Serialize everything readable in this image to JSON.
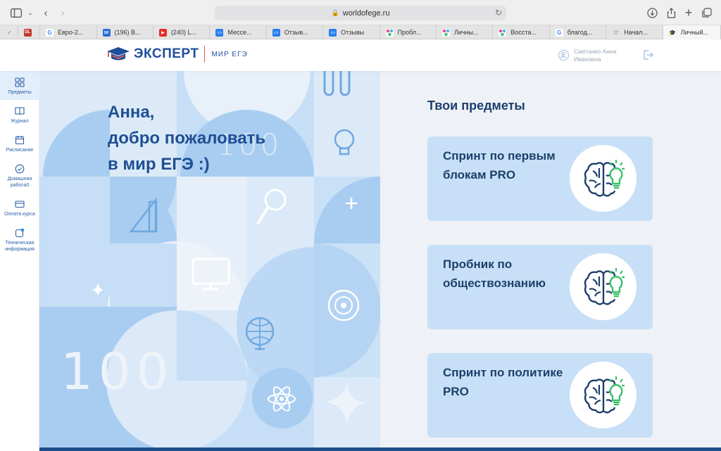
{
  "browser": {
    "url": "worldofege.ru",
    "tabs": [
      {
        "label": "",
        "icon": "check-icon"
      },
      {
        "label": "",
        "icon": "dl-icon"
      },
      {
        "label": "Евро-2...",
        "icon": "google-icon"
      },
      {
        "label": "(196) В...",
        "icon": "mail-icon"
      },
      {
        "label": "(240) L...",
        "icon": "youtube-icon"
      },
      {
        "label": "Мессе...",
        "icon": "chat-icon"
      },
      {
        "label": "Отзыв...",
        "icon": "chat-icon"
      },
      {
        "label": "Отзывы",
        "icon": "chat-icon"
      },
      {
        "label": "Пробл...",
        "icon": "dots-icon"
      },
      {
        "label": "Личны...",
        "icon": "dots-icon"
      },
      {
        "label": "Восста...",
        "icon": "dots-icon"
      },
      {
        "label": "благод...",
        "icon": "google-icon"
      },
      {
        "label": "Начал...",
        "icon": "star-icon"
      },
      {
        "label": "Личный...",
        "icon": "cap-icon"
      }
    ]
  },
  "header": {
    "logo_text": "ЭКСПЕРТ",
    "logo_sub": "МИР ЕГЭ",
    "user_name": "Сметанко Анна Ивановна"
  },
  "nav": [
    {
      "label": "Предметы",
      "icon": "grid-icon"
    },
    {
      "label": "Журнал",
      "icon": "book-icon"
    },
    {
      "label": "Расписание",
      "icon": "calendar-icon"
    },
    {
      "label": "Домашняя работа0",
      "icon": "check-circle-icon"
    },
    {
      "label": "Оплата курса",
      "icon": "card-icon"
    },
    {
      "label": "Техническая информация",
      "icon": "info-icon"
    }
  ],
  "hero": {
    "line1": "Анна,",
    "line2": "добро пожаловать",
    "line3": "в мир ЕГЭ :)",
    "deco_100": "100"
  },
  "subjects": {
    "title": "Твои предметы",
    "cards": [
      {
        "title": "Спринт по первым блокам PRO"
      },
      {
        "title": "Пробник по обществознанию"
      },
      {
        "title": "Спринт по политике PRO"
      }
    ]
  },
  "colors": {
    "brand": "#1e4f9c",
    "card_bg": "#c8e0f7",
    "panel_bg": "#eef1f5",
    "bulb_green": "#3cc06a"
  }
}
